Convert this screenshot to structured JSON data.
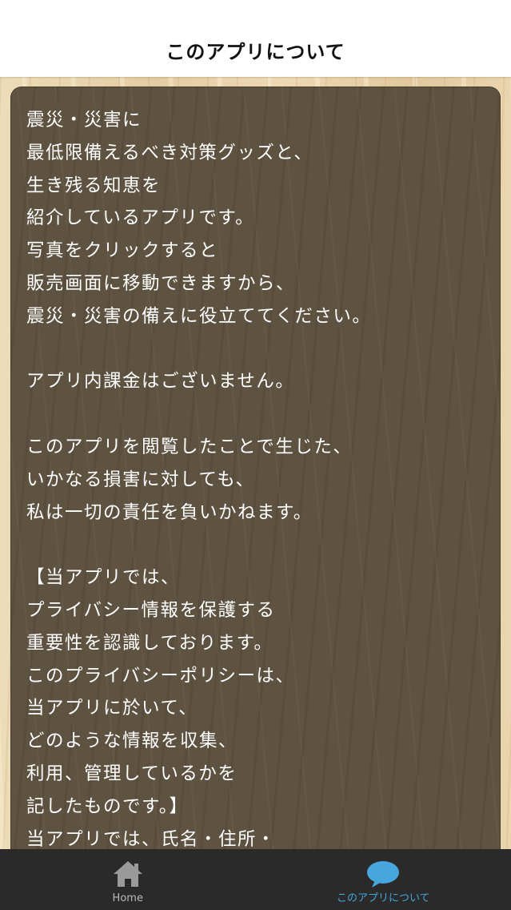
{
  "header": {
    "title": "このアプリについて"
  },
  "content": {
    "text": "震災・災害に\n最低限備えるべき対策グッズと、\n生き残る知恵を\n紹介しているアプリです。\n写真をクリックすると\n販売画面に移動できますから、\n震災・災害の備えに役立ててください。\n\nアプリ内課金はございません。\n\nこのアプリを閲覧したことで生じた、\nいかなる損害に対しても、\n私は一切の責任を負いかねます。\n\n【当アプリでは、\nプライバシー情報を保護する\n重要性を認識しております。\nこのプライバシーポリシーは、\n当アプリに於いて、\nどのような情報を収集、\n利用、管理しているかを\n記したものです。】\n当アプリでは、氏名・住所・"
  },
  "tabbar": {
    "tabs": [
      {
        "label": "Home",
        "icon": "home-icon",
        "active": false
      },
      {
        "label": "このアプリについて",
        "icon": "speech-bubble-icon",
        "active": true
      }
    ]
  },
  "colors": {
    "header_bg": "#ffffff",
    "panel_bg": "#5e5240",
    "wood_bg": "#e8d3ad",
    "tabbar_bg": "#2a2a2a",
    "tab_active": "#46a6dd",
    "tab_inactive": "#b8b8b8",
    "content_text": "#ffffff"
  }
}
